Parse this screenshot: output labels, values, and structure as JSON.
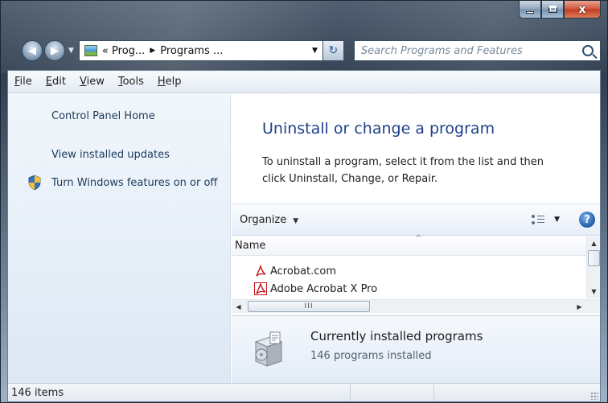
{
  "window": {
    "close_glyph": "x"
  },
  "navigation": {
    "back_glyph": "◀",
    "forward_glyph": "▶",
    "breadcrumb": [
      "«",
      "Prog...",
      "Programs ..."
    ],
    "breadcrumb_separator": "▶",
    "dropdown_glyph": "▼",
    "refresh_glyph": "↻",
    "search_placeholder": "Search Programs and Features"
  },
  "menubar": {
    "items": [
      {
        "key": "F",
        "rest": "ile"
      },
      {
        "key": "E",
        "rest": "dit"
      },
      {
        "key": "V",
        "rest": "iew"
      },
      {
        "key": "T",
        "rest": "ools"
      },
      {
        "key": "H",
        "rest": "elp"
      }
    ]
  },
  "left_pane": {
    "home": "Control Panel Home",
    "updates": "View installed updates",
    "features": "Turn Windows features on or off"
  },
  "main": {
    "title": "Uninstall or change a program",
    "description": "To uninstall a program, select it from the list and then click Uninstall, Change, or Repair."
  },
  "commandbar": {
    "organize": "Organize",
    "dropdown_glyph": "▼",
    "help_glyph": "?"
  },
  "list": {
    "column_name": "Name",
    "sort_glyph": "^",
    "rows": [
      "Acrobat.com",
      "Adobe Acrobat X Pro"
    ],
    "scroll_thumb_grip": "III",
    "arrow_up": "▲",
    "arrow_down": "▼",
    "arrow_left": "◀",
    "arrow_right": "▶"
  },
  "details": {
    "title": "Currently installed programs",
    "subtitle": "146 programs installed"
  },
  "status": {
    "items_count": "146 items"
  },
  "colors": {
    "accent_title": "#1e3f8a",
    "link": "#1c3b5c",
    "acrobat_red": "#c4151c"
  }
}
